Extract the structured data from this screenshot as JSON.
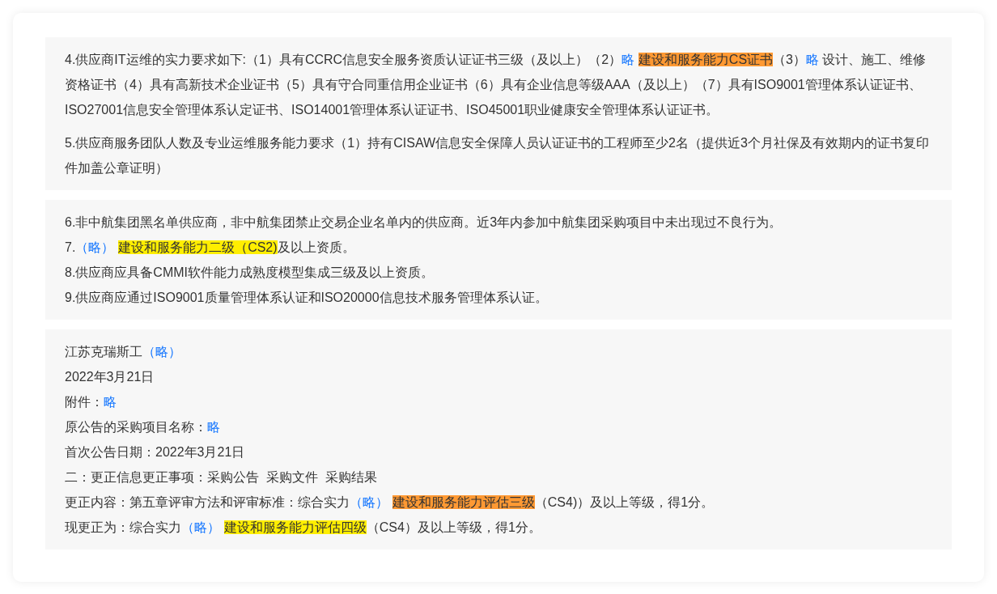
{
  "panels": [
    {
      "kind": "paragraphs",
      "lines": [
        {
          "segments": [
            {
              "kind": "text",
              "text": "4.供应商IT运维的实力要求如下:（1）具有CCRC信息安全服务资质认证证书三级（及以上）（2）"
            },
            {
              "kind": "link",
              "text": "略"
            },
            {
              "kind": "mark",
              "text": "建设和服务能力CS证书",
              "color": "#ff9933"
            },
            {
              "kind": "text",
              "text": "（3）"
            },
            {
              "kind": "link",
              "text": "略"
            },
            {
              "kind": "text",
              "text": " 设计、施工、维修资格证书（4）具有高新技术企业证书（5）具有守合同重信用企业证书（6）具有企业信息等级AAA（及以上）（7）具有ISO9001管理体系认证证书、 ISO27001信息安全管理体系认定证书、ISO14001管理体系认证证书、ISO45001职业健康安全管理体系认证证书。"
            }
          ]
        },
        {
          "segments": [
            {
              "kind": "text",
              "text": "5.供应商服务团队人数及专业运维服务能力要求（1）持有CISAW信息安全保障人员认证证书的工程师至少2名（提供近3个月社保及有效期内的证书复印件加盖公章证明）"
            }
          ]
        }
      ]
    },
    {
      "kind": "lines",
      "lines": [
        {
          "segments": [
            {
              "kind": "text",
              "text": "6.非中航集团黑名单供应商，非中航集团禁止交易企业名单内的供应商。近3年内参加中航集团采购项目中未出现过不良行为。"
            }
          ]
        },
        {
          "segments": [
            {
              "kind": "text",
              "text": "7."
            },
            {
              "kind": "link",
              "text": "（略）"
            },
            {
              "kind": "mark",
              "text": "建设和服务能力二级（CS2)",
              "color": "#ffee00"
            },
            {
              "kind": "text",
              "text": "及以上资质。"
            }
          ]
        },
        {
          "segments": [
            {
              "kind": "text",
              "text": "8.供应商应具备CMMI软件能力成熟度模型集成三级及以上资质。"
            }
          ]
        },
        {
          "segments": [
            {
              "kind": "text",
              "text": "9.供应商应通过ISO9001质量管理体系认证和ISO20000信息技术服务管理体系认证。"
            }
          ]
        }
      ]
    },
    {
      "kind": "lines",
      "lines": [
        {
          "segments": [
            {
              "kind": "text",
              "text": "江苏克瑞斯工"
            },
            {
              "kind": "link",
              "text": "（略）"
            }
          ]
        },
        {
          "segments": [
            {
              "kind": "text",
              "text": "2022年3月21日"
            }
          ]
        },
        {
          "segments": [
            {
              "kind": "text",
              "text": "附件："
            },
            {
              "kind": "link",
              "text": "略"
            }
          ]
        },
        {
          "segments": [
            {
              "kind": "text",
              "text": "原公告的采购项目名称："
            },
            {
              "kind": "link",
              "text": "略"
            }
          ]
        },
        {
          "segments": [
            {
              "kind": "text",
              "text": "首次公告日期：2022年3月21日"
            }
          ]
        },
        {
          "segments": [
            {
              "kind": "text",
              "text": "二：更正信息更正事项：采购公告  采购文件  采购结果"
            }
          ]
        },
        {
          "segments": [
            {
              "kind": "text",
              "text": "更正内容：第五章评审方法和评审标准：综合实力"
            },
            {
              "kind": "link",
              "text": "（略）"
            },
            {
              "kind": "mark",
              "text": "建设和服务能力评估三级",
              "color": "#ff9933"
            },
            {
              "kind": "text",
              "text": "（CS4)）及以上等级，得1分。"
            }
          ]
        },
        {
          "segments": [
            {
              "kind": "text",
              "text": "现更正为：综合实力"
            },
            {
              "kind": "link",
              "text": "（略）"
            },
            {
              "kind": "mark",
              "text": "建设和服务能力评估四级",
              "color": "#ffee00"
            },
            {
              "kind": "text",
              "text": "（CS4）及以上等级，得1分。"
            }
          ]
        }
      ]
    }
  ]
}
